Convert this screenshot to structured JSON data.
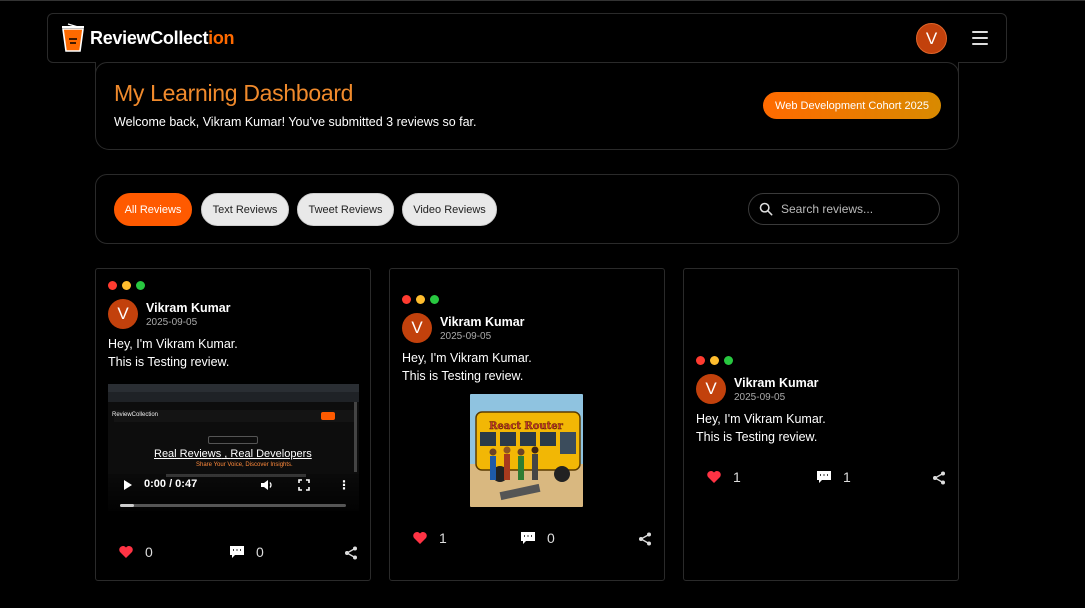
{
  "nav": {
    "logo_main": "ReviewCollect",
    "logo_accent": "ion",
    "avatar_initial": "V"
  },
  "dashboard": {
    "title": "My Learning Dashboard",
    "welcome": "Welcome back, Vikram Kumar! You've submitted 3 reviews so far.",
    "cohort": "Web Development Cohort 2025"
  },
  "filters": {
    "tabs": [
      {
        "label": "All Reviews",
        "active": true
      },
      {
        "label": "Text Reviews",
        "active": false
      },
      {
        "label": "Tweet Reviews",
        "active": false
      },
      {
        "label": "Video Reviews",
        "active": false
      }
    ],
    "search_placeholder": "Search reviews..."
  },
  "colors": {
    "accent": "#ff5a00",
    "title_orange": "#f08a2c",
    "avatar": "#c2410c",
    "like_red": "#ff3344"
  },
  "reviews": [
    {
      "initial": "V",
      "name": "Vikram Kumar",
      "date": "2025-09-05",
      "line1": "Hey, I'm Vikram Kumar.",
      "line2": "This is Testing review.",
      "media": "video",
      "video_time": "0:00 / 0:47",
      "video_headline_a": "Real Reviews",
      "video_headline_b": "Real Developers",
      "video_tagline": "Share Your Voice, Discover Insights.",
      "video_logo": "ReviewCollection",
      "likes": "0",
      "comments": "0"
    },
    {
      "initial": "V",
      "name": "Vikram Kumar",
      "date": "2025-09-05",
      "line1": "Hey, I'm Vikram Kumar.",
      "line2": "This is Testing review.",
      "media": "image",
      "image_caption": "React Router",
      "likes": "1",
      "comments": "0"
    },
    {
      "initial": "V",
      "name": "Vikram Kumar",
      "date": "2025-09-05",
      "line1": "Hey, I'm Vikram Kumar.",
      "line2": "This is Testing review.",
      "media": "none",
      "likes": "1",
      "comments": "1"
    }
  ]
}
